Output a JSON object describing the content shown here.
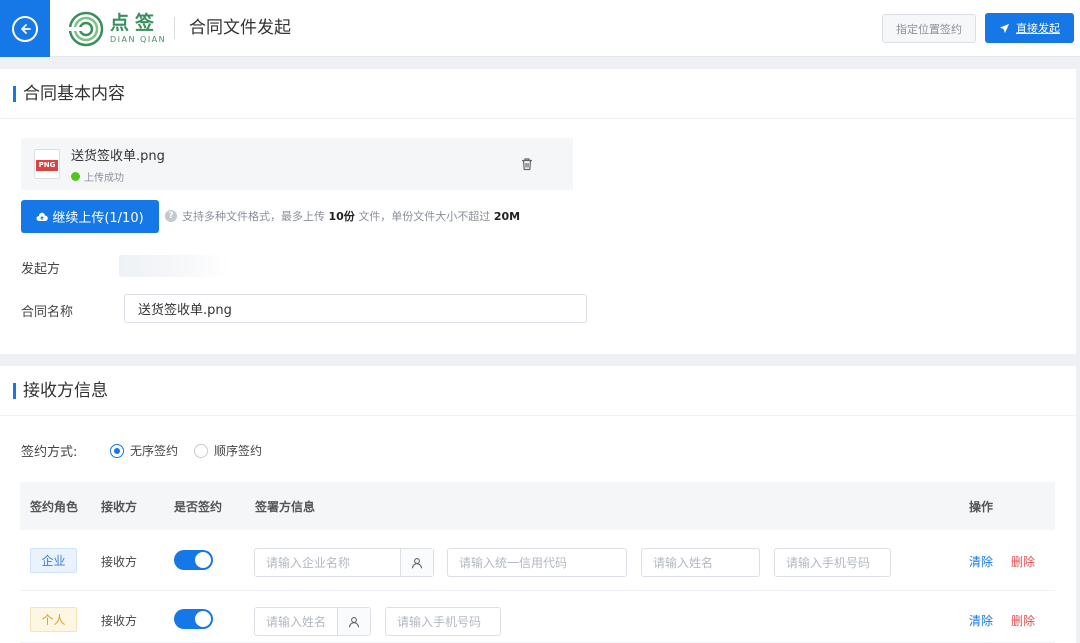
{
  "header": {
    "logo_cn": "点签",
    "logo_en": "DIAN QIAN",
    "page_title": "合同文件发起",
    "locate_button": "指定位置签约",
    "send_button": "直接发起"
  },
  "basic": {
    "section_title": "合同基本内容",
    "file": {
      "icon_tag": "PNG",
      "name": "送货签收单.png",
      "status": "上传成功"
    },
    "upload_button": "继续上传(1/10)",
    "tip_prefix": "支持多种文件格式，最多上传",
    "tip_max_files": "10份",
    "tip_middle": "文件，单份文件大小不超过",
    "tip_max_size": "20M",
    "initiator_label": "发起方",
    "contract_name_label": "合同名称",
    "contract_name_value": "送货签收单.png"
  },
  "receivers": {
    "section_title": "接收方信息",
    "sign_mode_label": "签约方式:",
    "modes": [
      {
        "label": "无序签约",
        "selected": true
      },
      {
        "label": "顺序签约",
        "selected": false
      }
    ],
    "columns": [
      "签约角色",
      "接收方",
      "是否签约",
      "签署方信息",
      "操作"
    ],
    "rows": [
      {
        "role": "企业",
        "receiver": "接收方",
        "sign": true,
        "placeholders": {
          "company": "请输入企业名称",
          "credit_code": "请输入统一信用代码",
          "name": "请输入姓名",
          "phone": "请输入手机号码"
        },
        "clear": "清除",
        "delete": "删除"
      },
      {
        "role": "个人",
        "receiver": "接收方",
        "sign": true,
        "placeholders": {
          "name": "请输入姓名",
          "phone": "请输入手机号码"
        },
        "clear": "清除",
        "delete": "删除"
      }
    ]
  },
  "colors": {
    "primary": "#1677e6",
    "success": "#52c41a",
    "danger": "#e55050",
    "brand_green": "#3a8f5e"
  }
}
